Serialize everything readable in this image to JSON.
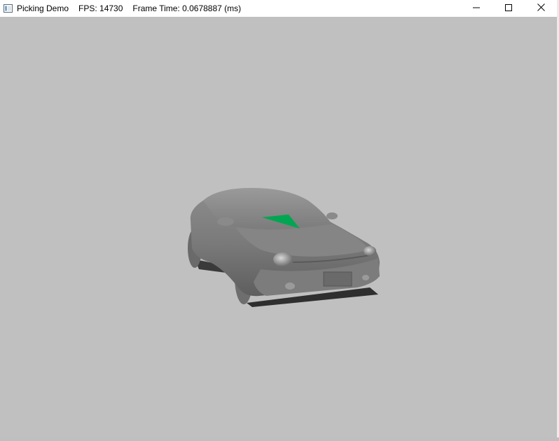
{
  "window": {
    "title": "Picking Demo",
    "fps": "FPS: 14730",
    "frame_time": "Frame Time: 0.0678887 (ms)",
    "icon": "app-window-icon",
    "controls": {
      "minimize": "minimize-icon",
      "maximize": "maximize-icon",
      "close": "close-icon"
    }
  },
  "scene": {
    "background_color": "#c0c0c0",
    "model": "car",
    "model_color": "#7a7a7a",
    "picked_triangle_color": "#00a651"
  }
}
